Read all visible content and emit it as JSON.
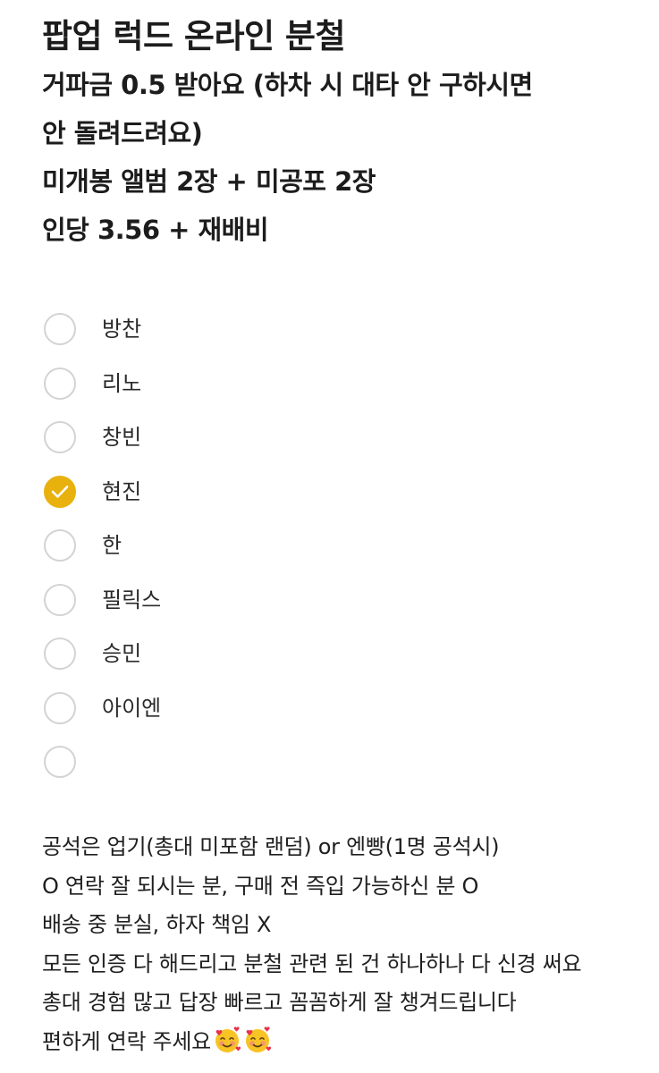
{
  "header": {
    "title": "팝업 럭드 온라인 분철",
    "lines": [
      "거파금 0.5 받아요 (하차 시 대타 안 구하시면",
      "안 돌려드려요)",
      "미개봉 앨범 2장 + 미공포 2장",
      "인당 3.56 + 재배비"
    ]
  },
  "checklist": {
    "accent_color": "#e8b10d",
    "items": [
      {
        "label": "방찬",
        "checked": false
      },
      {
        "label": "리노",
        "checked": false
      },
      {
        "label": "창빈",
        "checked": false
      },
      {
        "label": "현진",
        "checked": true
      },
      {
        "label": "한",
        "checked": false
      },
      {
        "label": "필릭스",
        "checked": false
      },
      {
        "label": "승민",
        "checked": false
      },
      {
        "label": "아이엔",
        "checked": false
      },
      {
        "label": "",
        "checked": false
      }
    ]
  },
  "notes": {
    "lines": [
      "공석은 업기(총대 미포함 랜덤) or 엔빵(1명 공석시)",
      "O 연락 잘 되시는 분, 구매 전 즉입 가능하신 분 O",
      "배송 중 분실, 하자 책임 X",
      "모든 인증 다 해드리고 분철 관련 된 건 하나하나 다 신경 써요",
      "총대 경험 많고 답장 빠르고 꼼꼼하게 잘 챙겨드립니다",
      "편하게 연락 주세요"
    ],
    "emoji_icons": [
      "smiling-face-with-hearts-icon",
      "smiling-face-with-hearts-icon"
    ]
  }
}
